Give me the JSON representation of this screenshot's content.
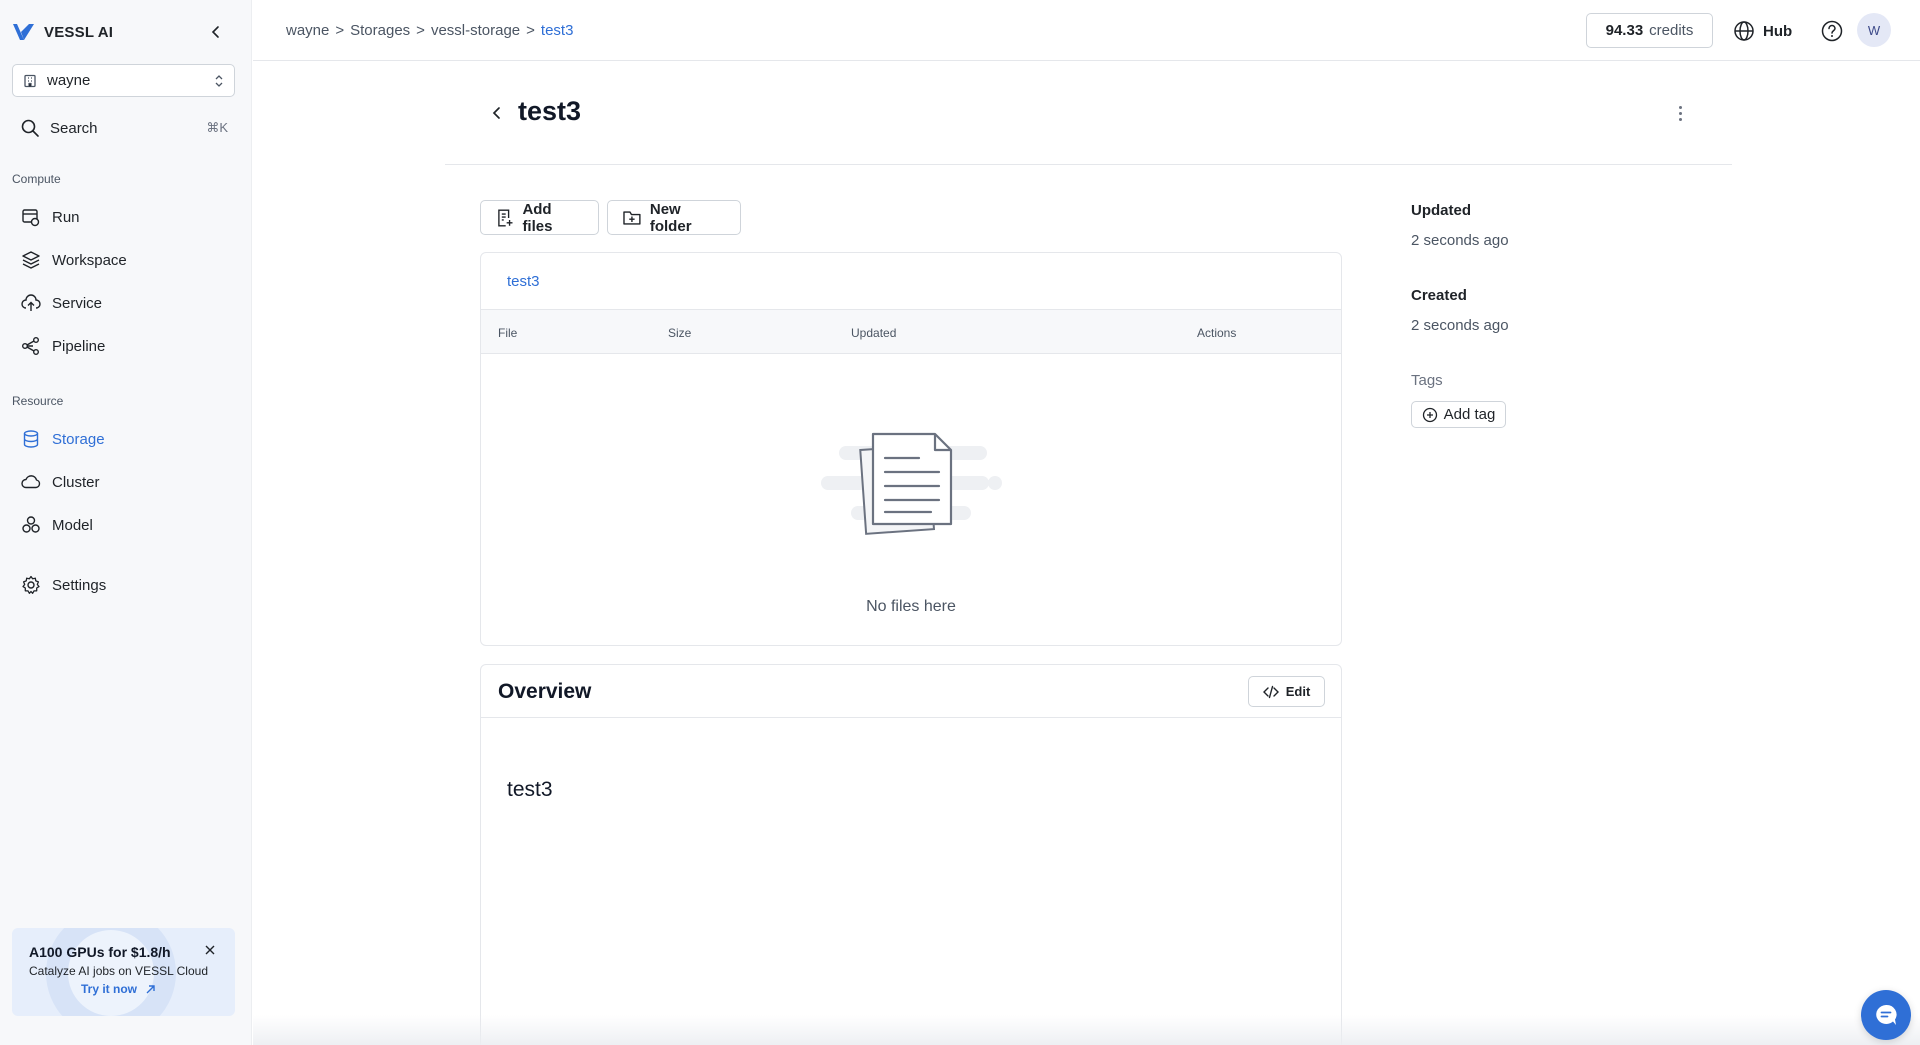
{
  "app": {
    "brand": "VESSL AI",
    "accent": "#2f6fd6"
  },
  "sidebar": {
    "org": "wayne",
    "search": {
      "label": "Search",
      "shortcut": "⌘K"
    },
    "sections": [
      {
        "label": "Compute"
      },
      {
        "label": "Resource"
      }
    ],
    "items": [
      {
        "label": "Run",
        "icon": "run-icon"
      },
      {
        "label": "Workspace",
        "icon": "layers-icon"
      },
      {
        "label": "Service",
        "icon": "upload-cloud-icon"
      },
      {
        "label": "Pipeline",
        "icon": "pipeline-icon"
      },
      {
        "label": "Storage",
        "icon": "database-icon",
        "active": true
      },
      {
        "label": "Cluster",
        "icon": "cloud-icon"
      },
      {
        "label": "Model",
        "icon": "model-icon"
      },
      {
        "label": "Settings",
        "icon": "gear-icon"
      }
    ],
    "promo": {
      "title": "A100 GPUs for $1.8/h",
      "subtitle": "Catalyze AI jobs on VESSL Cloud",
      "link": "Try it now"
    }
  },
  "topbar": {
    "breadcrumb": [
      "wayne",
      "Storages",
      "vessl-storage",
      "test3"
    ],
    "separator": ">",
    "credits_value": "94.33",
    "credits_unit": "credits",
    "hub": "Hub",
    "avatar": "W"
  },
  "page": {
    "title": "test3",
    "buttons": {
      "add_files": "Add files",
      "new_folder": "New folder"
    },
    "files": {
      "path": "test3",
      "columns": [
        "File",
        "Size",
        "Updated",
        "Actions"
      ],
      "rows": [],
      "empty_text": "No files here"
    },
    "overview": {
      "title": "Overview",
      "edit": "Edit",
      "body": "test3"
    },
    "meta": {
      "updated_label": "Updated",
      "updated_value": "2 seconds ago",
      "created_label": "Created",
      "created_value": "2 seconds ago",
      "tags_label": "Tags",
      "add_tag": "Add tag"
    }
  }
}
